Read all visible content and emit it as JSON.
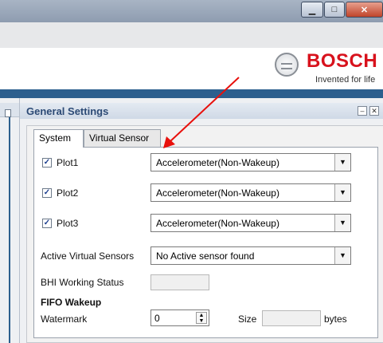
{
  "window": {
    "minimize_icon": "minimize-icon",
    "maximize_icon": "maximize-icon",
    "close_icon": "close-icon"
  },
  "brand": {
    "name": "BOSCH",
    "tagline": "Invented for life",
    "color": "#d8121d"
  },
  "panel": {
    "title": "General Settings"
  },
  "tabs": [
    {
      "label": "System",
      "active": true
    },
    {
      "label": "Virtual Sensor",
      "active": false
    }
  ],
  "plots": [
    {
      "label": "Plot1",
      "checked": true,
      "value": "Accelerometer(Non-Wakeup)"
    },
    {
      "label": "Plot2",
      "checked": true,
      "value": "Accelerometer(Non-Wakeup)"
    },
    {
      "label": "Plot3",
      "checked": true,
      "value": "Accelerometer(Non-Wakeup)"
    }
  ],
  "active_virtual_sensors": {
    "label": "Active Virtual Sensors",
    "value": "No Active sensor found"
  },
  "bhi_status": {
    "label": "BHI Working Status",
    "value": ""
  },
  "fifo": {
    "heading": "FIFO Wakeup",
    "watermark_label": "Watermark",
    "watermark_value": "0",
    "size_label": "Size",
    "size_value": "",
    "unit": "bytes"
  },
  "accent": {
    "header_blue": "#2c5f8e",
    "annotation_red": "#e8100c"
  }
}
